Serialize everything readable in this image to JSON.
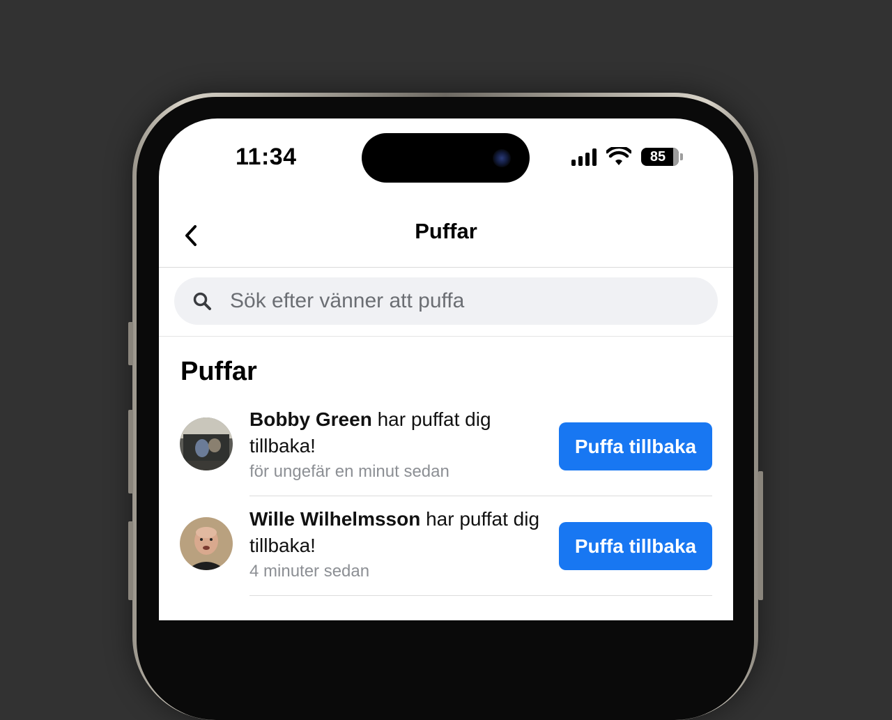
{
  "status_bar": {
    "time": "11:34",
    "battery": "85"
  },
  "nav": {
    "title": "Puffar"
  },
  "search": {
    "placeholder": "Sök efter vänner att puffa"
  },
  "section": {
    "title": "Puffar"
  },
  "pokes": [
    {
      "name": "Bobby Green",
      "message": " har puffat dig tillbaka!",
      "time_ago": "för ungefär en minut sedan",
      "action_label": "Puffa tillbaka"
    },
    {
      "name": "Wille Wilhelmsson",
      "message": " har puffat dig tillbaka!",
      "time_ago": "4 minuter sedan",
      "action_label": "Puffa tillbaka"
    }
  ],
  "colors": {
    "accent": "#1877f2",
    "background": "#323232",
    "search_bg": "#f0f1f4"
  }
}
